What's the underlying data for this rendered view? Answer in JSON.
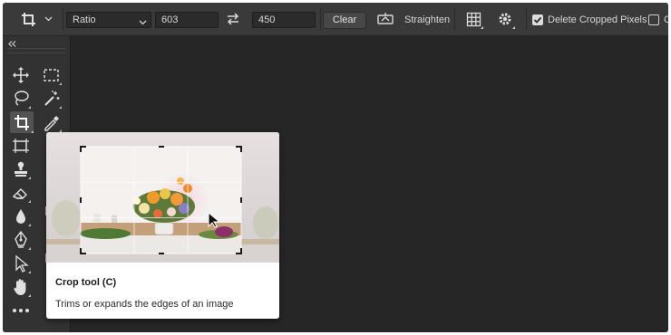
{
  "options_bar": {
    "crop_tool_icon": "crop-icon",
    "ratio_preset": "Ratio",
    "width_value": "603",
    "swap_icon": "swap-arrows-icon",
    "height_value": "450",
    "clear_label": "Clear",
    "straighten_icon": "straighten-level-icon",
    "straighten_label": "Straighten",
    "overlay_icon": "grid-overlay-icon",
    "settings_icon": "gear-icon",
    "delete_cropped_checked": true,
    "delete_cropped_label": "Delete Cropped Pixels",
    "truncated_label": "C"
  },
  "toolbar": {
    "collapse_icon": "double-chevron-left-icon",
    "tools": [
      {
        "name": "move-tool",
        "icon": "move-icon"
      },
      {
        "name": "rectangular-marquee-tool",
        "icon": "marquee-icon"
      },
      {
        "name": "lasso-tool",
        "icon": "lasso-icon"
      },
      {
        "name": "magic-wand-tool",
        "icon": "magic-wand-icon"
      },
      {
        "name": "crop-tool",
        "icon": "crop-icon",
        "active": true
      },
      {
        "name": "eyedropper-tool",
        "icon": "eyedropper-icon"
      },
      {
        "name": "frame-tool",
        "icon": "frame-icon"
      },
      {
        "name": "stamp-tool",
        "icon": "stamp-icon"
      },
      {
        "name": "eraser-tool",
        "icon": "eraser-icon"
      },
      {
        "name": "blur-tool",
        "icon": "drop-icon"
      },
      {
        "name": "pen-tool",
        "icon": "pen-icon"
      },
      {
        "name": "path-selection-tool",
        "icon": "arrow-pointer-icon"
      },
      {
        "name": "hand-tool",
        "icon": "hand-icon"
      },
      {
        "name": "more-tools",
        "icon": "ellipsis-icon"
      }
    ]
  },
  "tooltip": {
    "title": "Crop tool (C)",
    "description": "Trims or expands the edges of an image",
    "preview_icon": "cursor-arrow-icon"
  },
  "colors": {
    "canvas_bg": "#262626",
    "panel_bg": "#3a3a3a",
    "toolbar_bg": "#323232",
    "tooltip_bg": "#ffffff"
  }
}
